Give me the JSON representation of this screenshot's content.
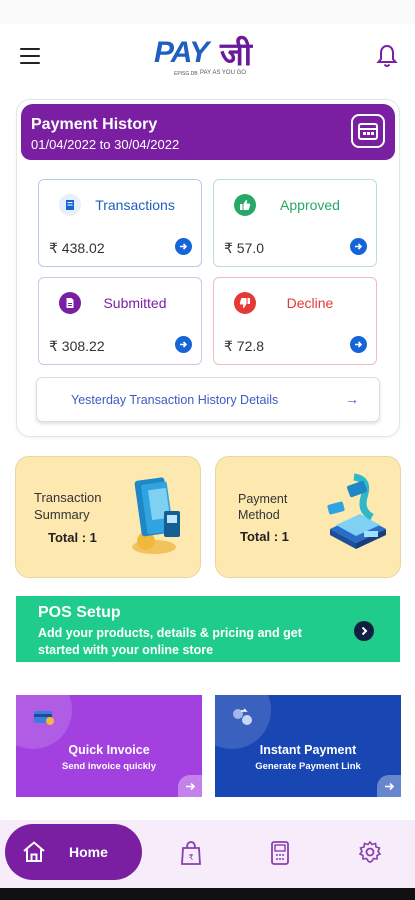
{
  "header": {
    "logo_pay": "PAY",
    "logo_ji": "जी",
    "logo_small": "EPISG DB",
    "logo_tagline": "PAY AS YOU GO"
  },
  "history": {
    "title": "Payment History",
    "range": "01/04/2022 to 30/04/2022",
    "stats": {
      "transactions": {
        "label": "Transactions",
        "amount": "₹ 438.02"
      },
      "approved": {
        "label": "Approved",
        "amount": "₹ 57.0"
      },
      "submitted": {
        "label": "Submitted",
        "amount": "₹ 308.22"
      },
      "decline": {
        "label": "Decline",
        "amount": "₹ 72.8"
      }
    },
    "yesterday_label": "Yesterday Transaction History Details",
    "yesterday_arrow": "→"
  },
  "tiles": {
    "summary": {
      "line1": "Transaction",
      "line2": "Summary",
      "total": "Total : 1"
    },
    "method": {
      "line1": "Payment",
      "line2": "Method",
      "total": "Total : 1"
    }
  },
  "pos": {
    "title": "POS Setup",
    "description": "Add your products, details & pricing and get started with your online store"
  },
  "quick": {
    "invoice": {
      "title": "Quick Invoice",
      "subtitle": "Send invoice quickly"
    },
    "payment": {
      "title": "Instant Payment",
      "subtitle": "Generate Payment Link"
    }
  },
  "nav": {
    "home_label": "Home"
  },
  "colors": {
    "primary_purple": "#7b1fa2",
    "blue": "#1565d8",
    "green": "#1fcc8c",
    "approved_green": "#27a866",
    "decline_red": "#e53935",
    "tile_yellow": "#fde9b0"
  }
}
